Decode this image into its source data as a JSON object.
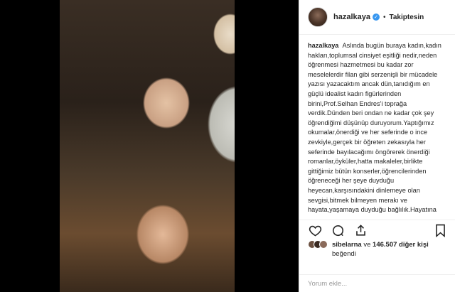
{
  "colors": {
    "accent": "#3897f0",
    "text": "#262626",
    "muted": "#999999",
    "border": "#efefef",
    "media_bg": "#000000"
  },
  "header": {
    "username": "hazalkaya",
    "verified_icon": "verified-badge-icon",
    "separator": "•",
    "follow_status": "Takiptesin"
  },
  "caption": {
    "username": "hazalkaya",
    "text": "Aslında bugün buraya kadın,kadın hakları,toplumsal cinsiyet eşitliği nedir,neden öğrenmesi hazmetmesi bu kadar zor meselelerdir filan gibi serzenişli bir mücadele yazısı yazacaktım ancak dün,tanıdığım en güçlü idealist kadın figürlerinden birini,Prof.Selhan Endres'i toprağa verdik.Dünden beri ondan ne kadar çok şey öğrendiğimi düşünüp duruyorum.Yaptığımız okumalar,önerdiği ve her seferinde o ince zevkiyle,gerçek bir öğreten zekasıyla her seferinde bayılacağımı öngörerek önerdiği romanlar,öyküler,hatta makaleler,birlikte gittiğimiz bütün konserler,öğrencilerinden öğreneceği her şeye duyduğu heyecan,karşısındakini dinlemeye olan sevgisi,bitmek bilmeyen merakı ve hayata,yaşamaya duyduğu bağlılık.Hayatına"
  },
  "actions": {
    "like_icon": "heart-icon",
    "comment_icon": "comment-icon",
    "share_icon": "share-icon",
    "save_icon": "bookmark-icon"
  },
  "likes": {
    "first_user": "sibelarna",
    "conjunction": "ve",
    "others_count": "146.507",
    "others_label": "diğer kişi",
    "suffix": "beğendi"
  },
  "comment": {
    "placeholder": "Yorum ekle..."
  }
}
